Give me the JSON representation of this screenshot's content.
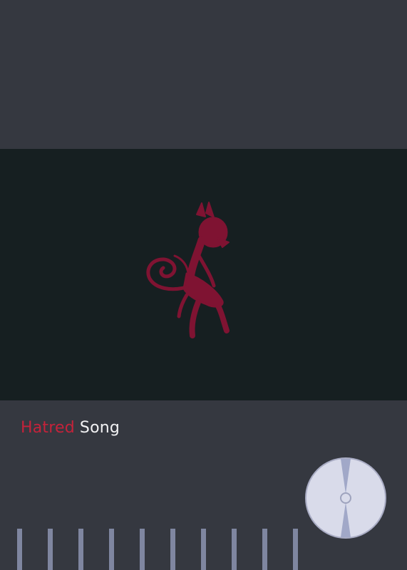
{
  "song": {
    "title_accent": "Hatred",
    "title_rest": "Song"
  },
  "artwork": {
    "icon": "red-demon-creature-icon"
  },
  "disc": {
    "icon": "cd-disc-icon"
  },
  "visualizer": {
    "bar_count": 10
  },
  "colors": {
    "background": "#353840",
    "artwork_background": "#161f21",
    "accent": "#c5223a",
    "title_text": "#f2f2f4",
    "bar": "#7f86a0",
    "disc": "#d9dbea"
  }
}
